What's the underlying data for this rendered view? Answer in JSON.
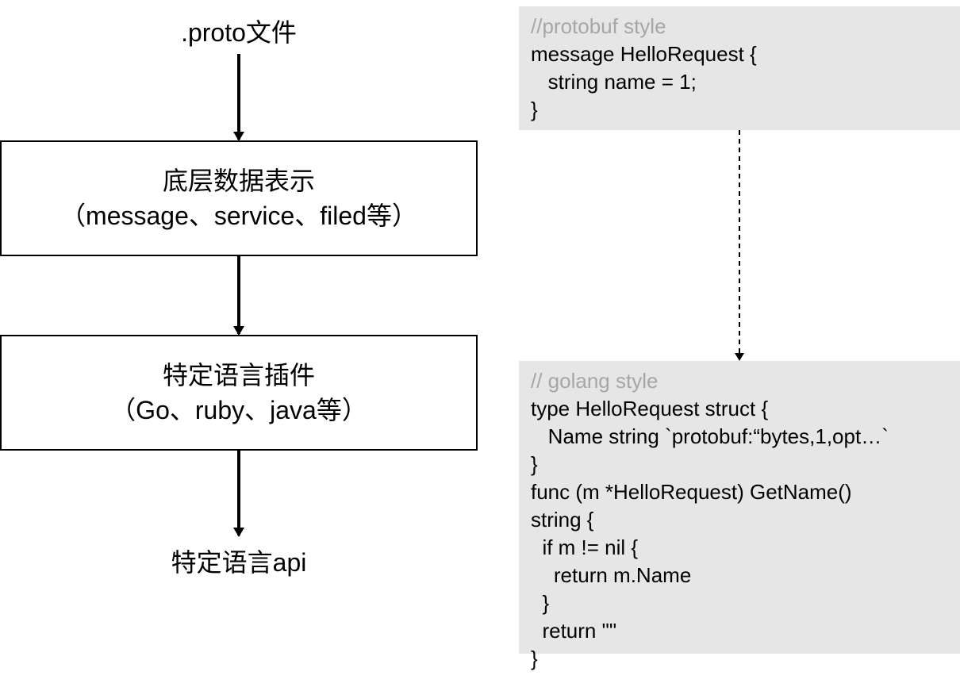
{
  "flow": {
    "top_label": ".proto文件",
    "box1": {
      "title": "底层数据表示",
      "subtitle": "（message、service、filed等）"
    },
    "box2": {
      "title": "特定语言插件",
      "subtitle": "（Go、ruby、java等）"
    },
    "bottom_label": "特定语言api"
  },
  "protobuf_panel": {
    "lines": [
      {
        "text": "//protobuf style",
        "kind": "comment"
      },
      {
        "text": "message HelloRequest {",
        "kind": "code"
      },
      {
        "text": "   string name = 1;",
        "kind": "code"
      },
      {
        "text": "}",
        "kind": "code"
      }
    ]
  },
  "golang_panel": {
    "lines": [
      {
        "text": "// golang style",
        "kind": "comment"
      },
      {
        "text": "type HelloRequest struct {",
        "kind": "code"
      },
      {
        "text": "   Name string `protobuf:“bytes,1,opt…`",
        "kind": "code"
      },
      {
        "text": "}",
        "kind": "code"
      },
      {
        "text": "func (m *HelloRequest) GetName()",
        "kind": "code"
      },
      {
        "text": "string {",
        "kind": "code"
      },
      {
        "text": "  if m != nil {",
        "kind": "code"
      },
      {
        "text": "    return m.Name",
        "kind": "code"
      },
      {
        "text": "  }",
        "kind": "code"
      },
      {
        "text": "  return \"\"",
        "kind": "code"
      },
      {
        "text": "}",
        "kind": "code"
      }
    ]
  },
  "colors": {
    "panel_background": "#e6e6e6",
    "comment_text": "#a6a6a6",
    "lines": "#000000"
  }
}
